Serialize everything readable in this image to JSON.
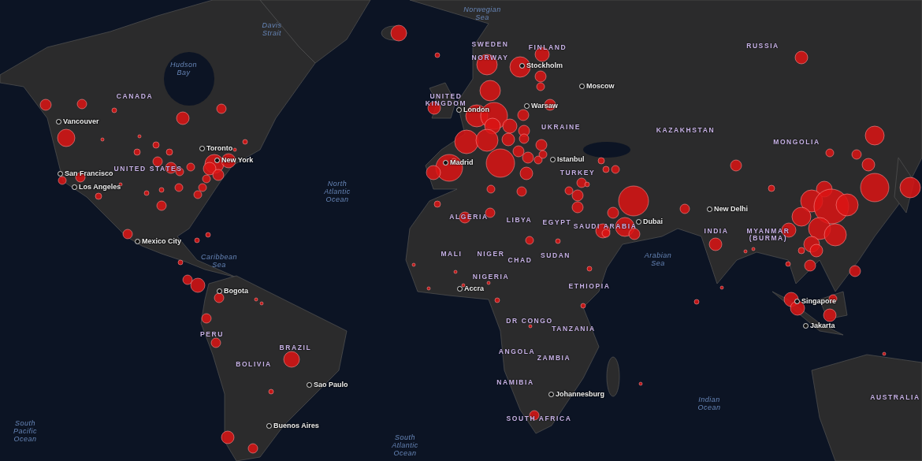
{
  "labels": [
    {
      "kind": "water",
      "text": "Davis Strait"
    },
    {
      "kind": "water",
      "text": "Hudson Bay"
    },
    {
      "kind": "water",
      "text": "Norwegian Sea"
    },
    {
      "kind": "water",
      "text": "North Atlantic Ocean"
    },
    {
      "kind": "water",
      "text": "Caribbean Sea"
    },
    {
      "kind": "water",
      "text": "Arabian Sea"
    },
    {
      "kind": "water",
      "text": "Indian Ocean"
    },
    {
      "kind": "water",
      "text": "South Pacific Ocean"
    },
    {
      "kind": "water",
      "text": "South Atlantic Ocean"
    },
    {
      "kind": "country",
      "text": "CANADA"
    },
    {
      "kind": "country",
      "text": "UNITED STATES"
    },
    {
      "kind": "country",
      "text": "SWEDEN"
    },
    {
      "kind": "country",
      "text": "FINLAND"
    },
    {
      "kind": "country",
      "text": "NORWAY"
    },
    {
      "kind": "country",
      "text": "UNITED KINGDOM"
    },
    {
      "kind": "country",
      "text": "UKRAINE"
    },
    {
      "kind": "country",
      "text": "TURKEY"
    },
    {
      "kind": "country",
      "text": "RUSSIA"
    },
    {
      "kind": "country",
      "text": "KAZAKHSTAN"
    },
    {
      "kind": "country",
      "text": "MONGOLIA"
    },
    {
      "kind": "country",
      "text": "ALGERIA"
    },
    {
      "kind": "country",
      "text": "LIBYA"
    },
    {
      "kind": "country",
      "text": "EGYPT"
    },
    {
      "kind": "country",
      "text": "SAUDI ARABIA"
    },
    {
      "kind": "country",
      "text": "MALI"
    },
    {
      "kind": "country",
      "text": "NIGER"
    },
    {
      "kind": "country",
      "text": "CHAD"
    },
    {
      "kind": "country",
      "text": "SUDAN"
    },
    {
      "kind": "country",
      "text": "NIGERIA"
    },
    {
      "kind": "country",
      "text": "ETHIOPIA"
    },
    {
      "kind": "country",
      "text": "DR CONGO"
    },
    {
      "kind": "country",
      "text": "TANZANIA"
    },
    {
      "kind": "country",
      "text": "ANGOLA"
    },
    {
      "kind": "country",
      "text": "ZAMBIA"
    },
    {
      "kind": "country",
      "text": "NAMIBIA"
    },
    {
      "kind": "country",
      "text": "SOUTH AFRICA"
    },
    {
      "kind": "country",
      "text": "INDIA"
    },
    {
      "kind": "country",
      "text": "MYANMAR (BURMA)"
    },
    {
      "kind": "country",
      "text": "BRAZIL"
    },
    {
      "kind": "country",
      "text": "PERU"
    },
    {
      "kind": "country",
      "text": "BOLIVIA"
    },
    {
      "kind": "country",
      "text": "AUSTRALIA"
    },
    {
      "kind": "city",
      "text": "Stockholm"
    },
    {
      "kind": "city",
      "text": "Moscow"
    },
    {
      "kind": "city",
      "text": "Warsaw"
    },
    {
      "kind": "city",
      "text": "London"
    },
    {
      "kind": "city",
      "text": "Vancouver"
    },
    {
      "kind": "city",
      "text": "Toronto"
    },
    {
      "kind": "city",
      "text": "New York"
    },
    {
      "kind": "city",
      "text": "Madrid"
    },
    {
      "kind": "city",
      "text": "Istanbul"
    },
    {
      "kind": "city",
      "text": "San Francisco"
    },
    {
      "kind": "city",
      "text": "Los Angeles"
    },
    {
      "kind": "city",
      "text": "New Delhi"
    },
    {
      "kind": "city",
      "text": "Dubai"
    },
    {
      "kind": "city",
      "text": "Mexico City"
    },
    {
      "kind": "city",
      "text": "Accra"
    },
    {
      "kind": "city",
      "text": "Bogota"
    },
    {
      "kind": "city",
      "text": "Singapore"
    },
    {
      "kind": "city",
      "text": "Jakarta"
    },
    {
      "kind": "city",
      "text": "Sao Paulo"
    },
    {
      "kind": "city",
      "text": "Johannesburg"
    },
    {
      "kind": "city",
      "text": "Buenos Aires"
    }
  ]
}
